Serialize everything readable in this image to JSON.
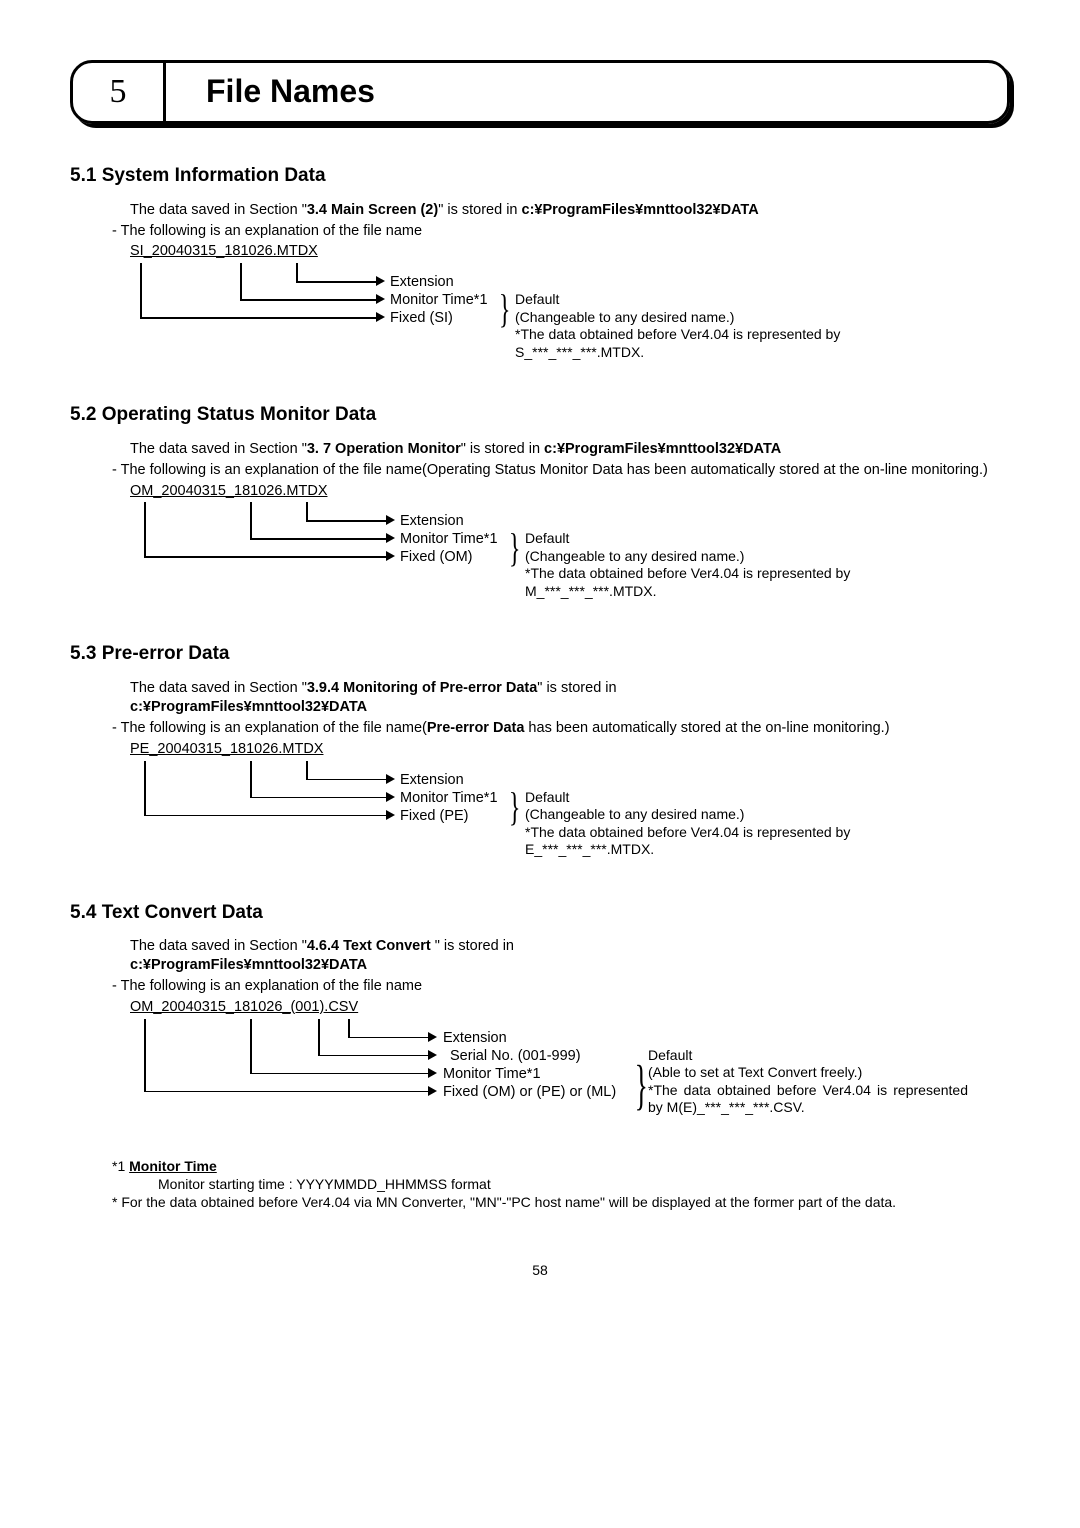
{
  "chapter": {
    "number": "5",
    "title": "File Names"
  },
  "sections": {
    "s1": {
      "heading": "5.1 System Information Data",
      "intro1a": "The data saved in Section \"",
      "intro1b": "3.4 Main Screen (2)",
      "intro1c": "\" is stored in ",
      "intro1d": "c:¥ProgramFiles¥mnttool32¥DATA",
      "bullet": "-   The following is an explanation of the file name",
      "filename": "SI_20040315_181026.MTDX",
      "lab_ext": "Extension",
      "lab_time": "Monitor Time*1",
      "lab_fixed": "Fixed (SI)",
      "note1": "Default",
      "note2": "(Changeable to any desired name.)",
      "note3": "*The data obtained before Ver4.04 is represented by",
      "note4": "  S_***_***_***.MTDX."
    },
    "s2": {
      "heading": "5.2 Operating Status Monitor Data",
      "intro1a": "The data saved in Section \"",
      "intro1b": "3. 7 Operation Monitor",
      "intro1c": "\" is stored in ",
      "intro1d": "c:¥ProgramFiles¥mnttool32¥DATA",
      "bullet": "- The following is an explanation of the file name(Operating Status Monitor Data has been automatically stored at the on-line monitoring.)",
      "filename": "OM_20040315_181026.MTDX",
      "lab_ext": "Extension",
      "lab_time": "Monitor Time*1",
      "lab_fixed": "Fixed (OM)",
      "note1": "Default",
      "note2": "(Changeable to any desired name.)",
      "note3": "*The data obtained before Ver4.04 is represented by",
      "note4": "  M_***_***_***.MTDX."
    },
    "s3": {
      "heading": "5.3 Pre-error Data",
      "intro1a": "The data saved in Section \"",
      "intro1b": "3.9.4 Monitoring of Pre-error Data",
      "intro1c": "\" is stored in",
      "intro1d": "c:¥ProgramFiles¥mnttool32¥DATA",
      "bullet_a": "- The following is an explanation of the file name(",
      "bullet_b": "Pre-error Data",
      "bullet_c": " has been automatically stored at the on-line monitoring.)",
      "filename": "PE_20040315_181026.MTDX",
      "lab_ext": "Extension",
      "lab_time": "Monitor Time*1",
      "lab_fixed": "Fixed (PE)",
      "note1": "Default",
      "note2": "(Changeable to any desired name.)",
      "note3": "*The data obtained before Ver4.04 is represented by",
      "note4": "  E_***_***_***.MTDX."
    },
    "s4": {
      "heading": "5.4 Text Convert Data",
      "intro1a": "The data saved in Section \"",
      "intro1b": "4.6.4 Text Convert ",
      "intro1c": "\" is stored in",
      "intro1d": "c:¥ProgramFiles¥mnttool32¥DATA",
      "bullet": "-   The following is an explanation of the file name",
      "filename": "OM_20040315_181026_(001).CSV",
      "lab_ext": "Extension",
      "lab_serial": "Serial No. (001-999)",
      "lab_time": "Monitor Time*1",
      "lab_fixed": "Fixed (OM) or (PE) or (ML)",
      "note1": "Default",
      "note2": "(Able to set at Text Convert freely.)",
      "note3": "*The data obtained before Ver4.04 is represented by M(E)_***_***_***.CSV."
    }
  },
  "footnotes": {
    "f1a": "*1 ",
    "f1b": "Monitor Time",
    "f1c": "Monitor starting time : YYYYMMDD_HHMMSS format",
    "f2": "* For the data obtained before Ver4.04 via MN Converter, \"MN\"-\"PC host name\" will be displayed at the former part of the data."
  },
  "page": "58"
}
